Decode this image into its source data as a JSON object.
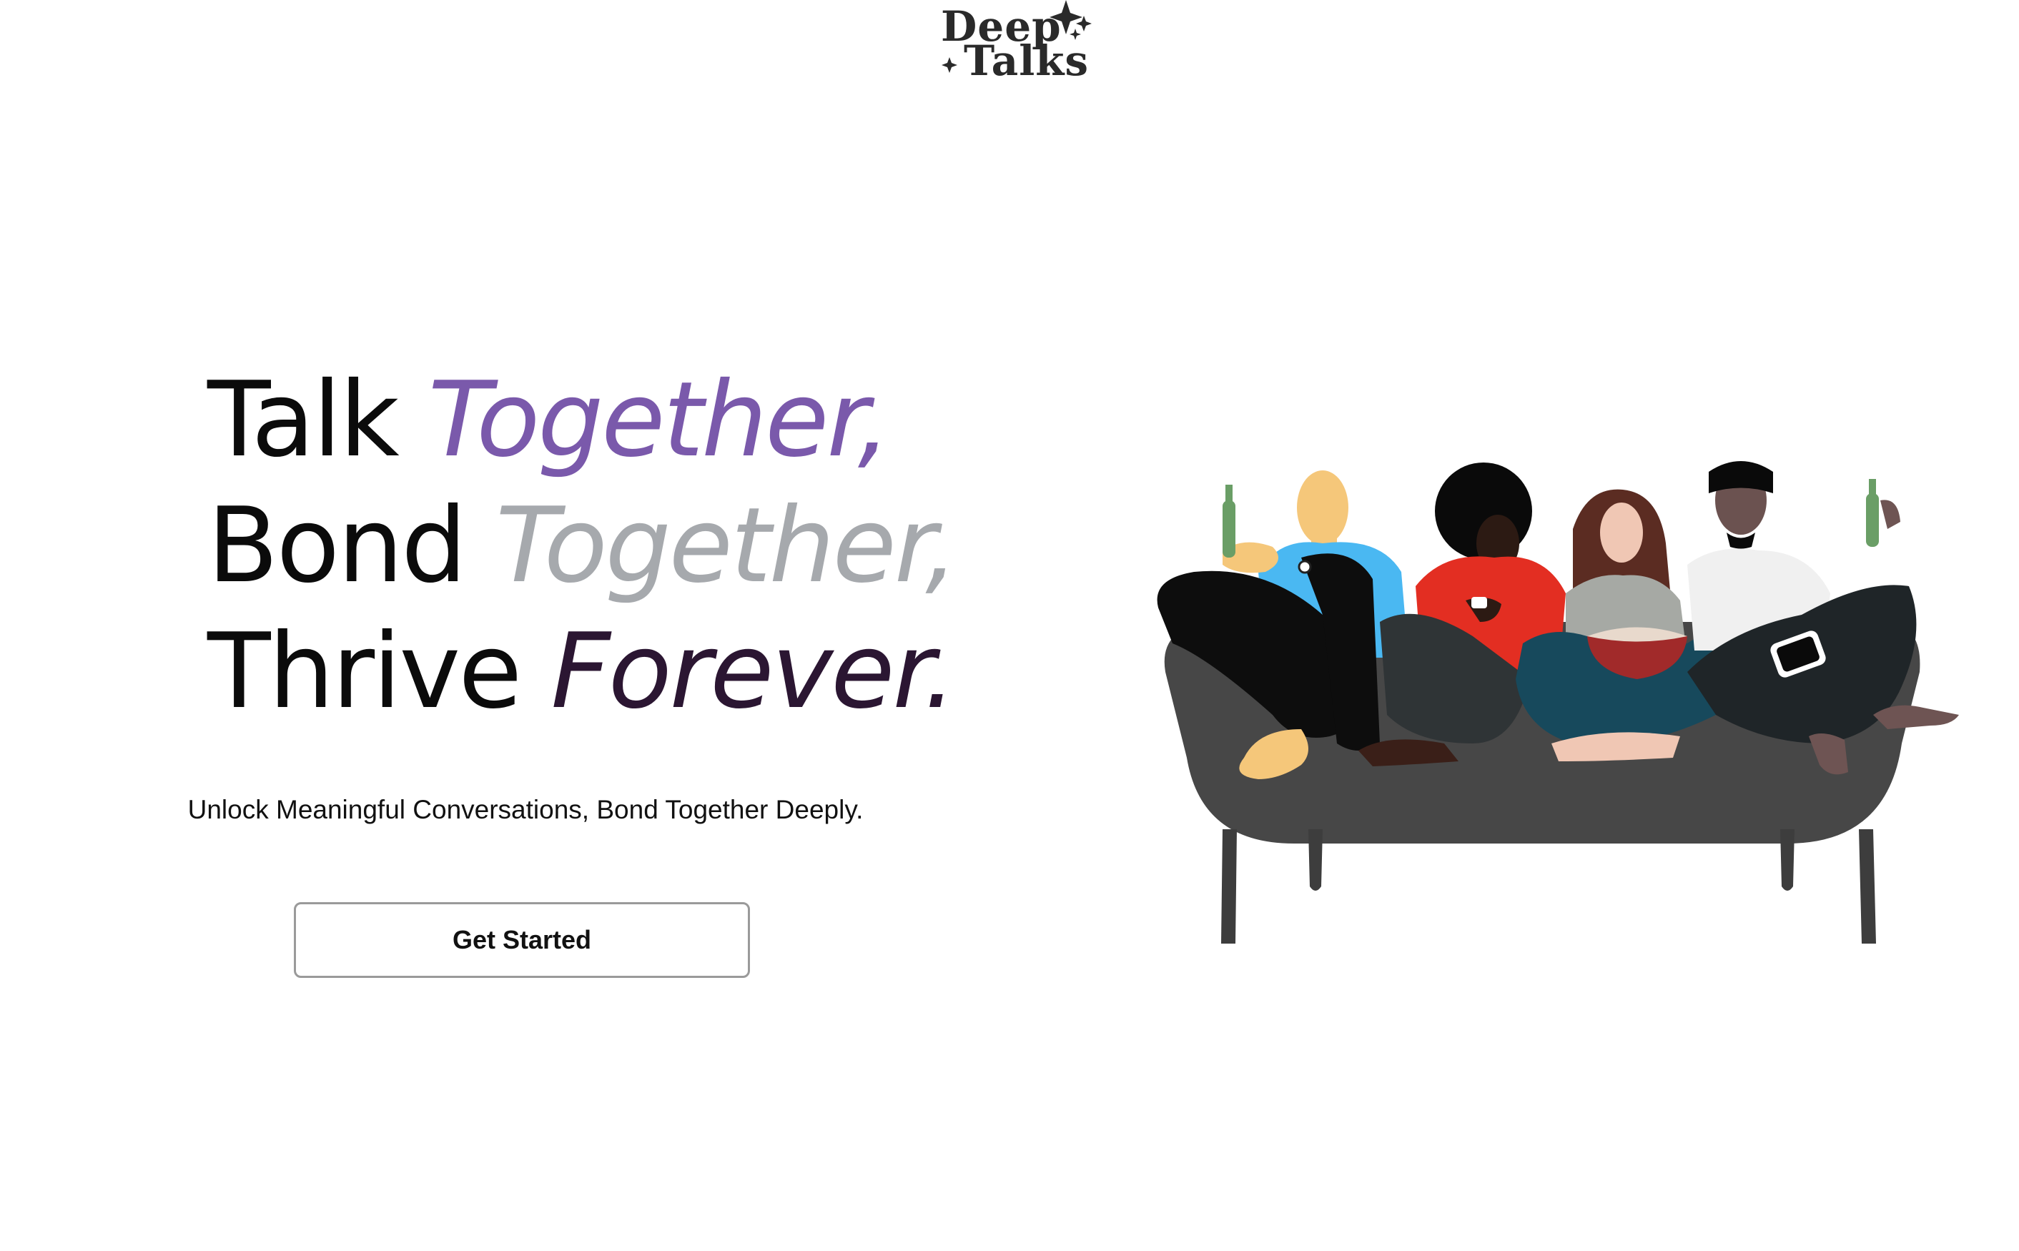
{
  "logo": {
    "line1": "Deep",
    "line2": "Talks"
  },
  "hero": {
    "line1_plain": "Talk ",
    "line1_accent": "Together,",
    "line2_plain": "Bond ",
    "line2_accent": "Together,",
    "line3_plain": "Thrive ",
    "line3_accent": "Forever."
  },
  "subtitle": "Unlock Meaningful Conversations, Bond Together Deeply.",
  "cta": {
    "label": "Get Started"
  },
  "colors": {
    "accent_purple": "#7a59ab",
    "accent_gray": "#a6a9ad",
    "accent_dark": "#2b1632"
  },
  "illustration": {
    "icon": "friends-on-couch-illustration"
  }
}
